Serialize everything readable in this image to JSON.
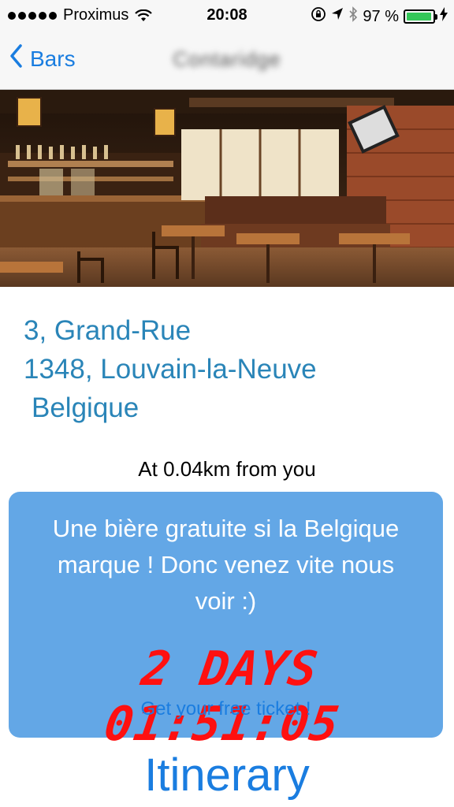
{
  "status_bar": {
    "carrier": "Proximus",
    "time": "20:08",
    "battery_percent": "97 %",
    "battery_level": 0.97,
    "icons": [
      "wifi-icon",
      "orientation-lock-icon",
      "location-arrow-icon",
      "bluetooth-icon",
      "battery-icon",
      "charging-bolt-icon"
    ]
  },
  "nav": {
    "back_label": "Bars",
    "title": "Contaridge"
  },
  "photo": {
    "description_icon": "bar-interior-photo"
  },
  "address": {
    "line1": "3, Grand-Rue",
    "line2": "1348, Louvain-la-Neuve",
    "line3": "Belgique"
  },
  "distance": "At 0.04km from you",
  "promo": {
    "message": "Une bière gratuite si la Belgique marque ! Donc venez vite nous voir :)",
    "countdown": "2 DAYS 01:51:05",
    "ticket_link": "Get your free ticket !"
  },
  "itinerary_label": "Itinerary",
  "colors": {
    "accent": "#1a7de0",
    "address": "#2a85b8",
    "promo_bg": "#63a7e6",
    "countdown": "#ff1010"
  }
}
